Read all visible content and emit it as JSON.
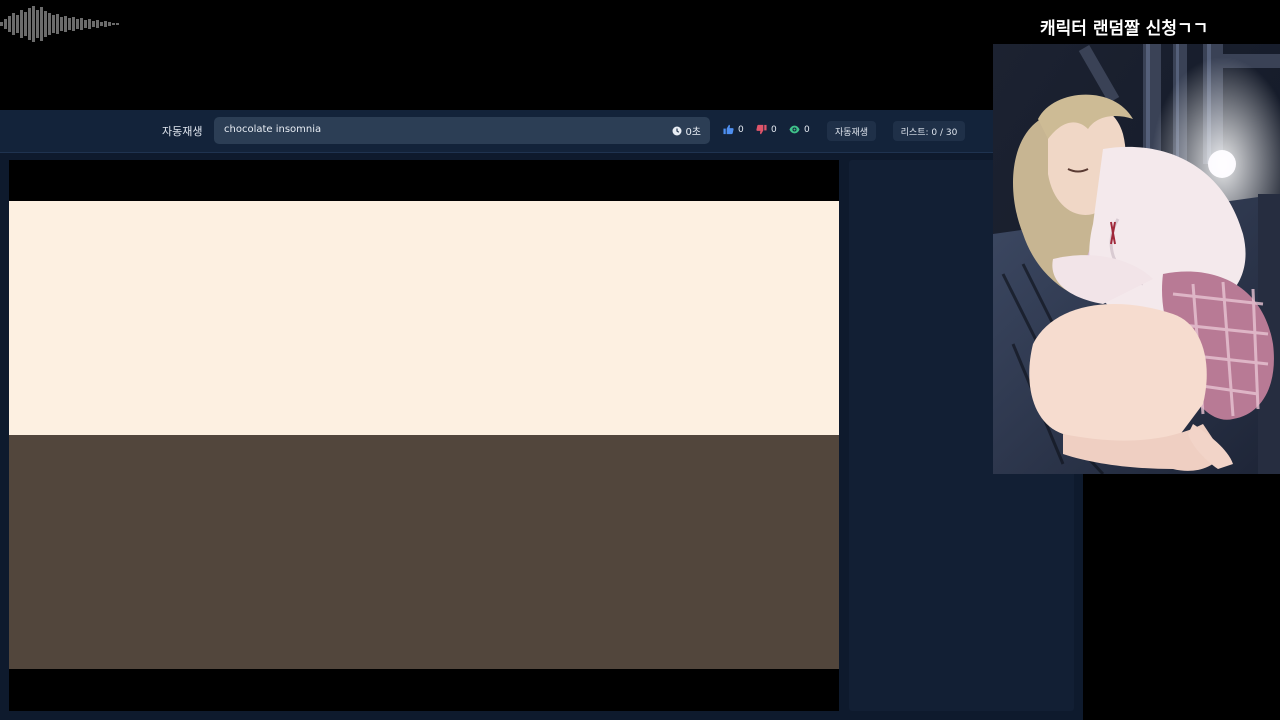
{
  "overlay": {
    "title": "캐릭터 랜덤짤 신청ㄱㄱ"
  },
  "toolbar": {
    "autoplay_label": "자동재생",
    "track_value": "chocolate insomnia",
    "timer": "0초",
    "likes": "0",
    "dislikes": "0",
    "views": "0",
    "autoplay_button": "자동재생",
    "list_count": "리스트: 0 / 30"
  },
  "icons": {
    "timer": "clock-icon",
    "likes": "thumbs-up-icon",
    "dislikes": "thumbs-down-icon",
    "views": "eye-icon"
  },
  "colors": {
    "background": "#000000",
    "toolbar": "#13233a",
    "input": "#2c3e55",
    "panel": "#121f34",
    "like": "#4e8ff0",
    "dislike": "#e0556a",
    "views": "#3fc28a",
    "player_top": "#fdf0e1",
    "player_bottom": "#52463c"
  }
}
